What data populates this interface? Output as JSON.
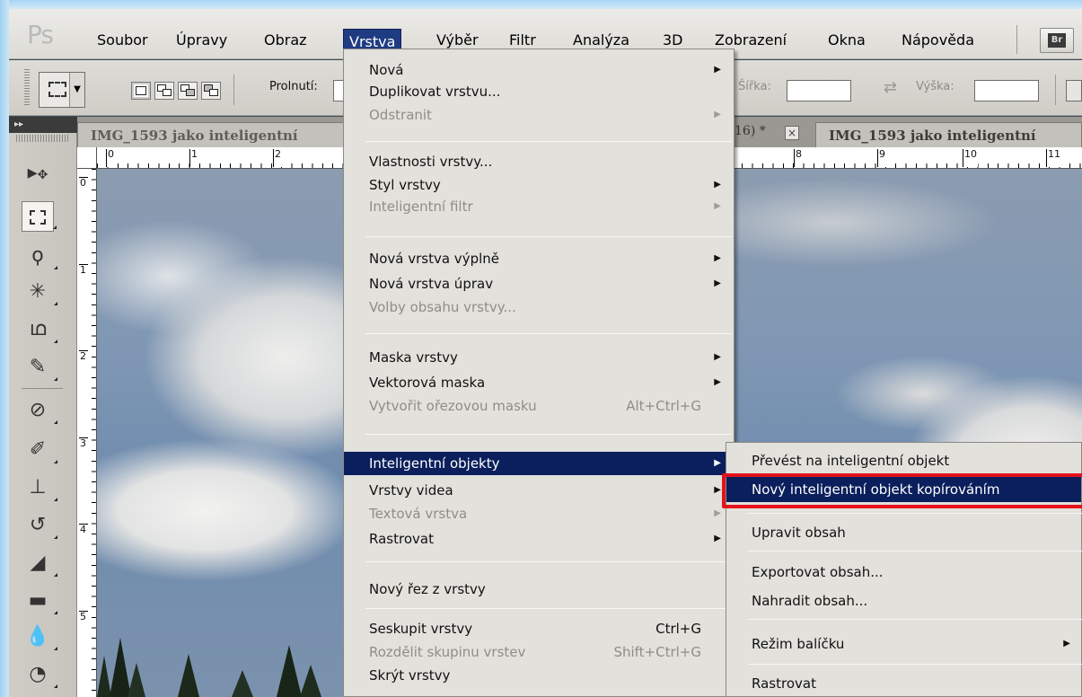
{
  "menubar": {
    "logo": "Ps",
    "items": [
      "Soubor",
      "Úpravy",
      "Obraz",
      "Vrstva",
      "Výběr",
      "Filtr",
      "Analýza",
      "3D",
      "Zobrazení",
      "Okna",
      "Nápověda"
    ],
    "active": "Vrstva",
    "bridge_label": "Br"
  },
  "options": {
    "feather_label": "Prolnutí:",
    "width_label": "Šířka:",
    "height_label": "Výška:"
  },
  "tabs": {
    "left": "IMG_1593 jako inteligentní",
    "mid_fragment": "16) *",
    "close": "×",
    "right": "IMG_1593 jako inteligentní"
  },
  "rulers": {
    "top": [
      "0",
      "1",
      "2",
      "8",
      "9",
      "10",
      "11"
    ],
    "left": [
      "0",
      "1",
      "2",
      "3",
      "4",
      "5"
    ]
  },
  "tools": [
    "move-icon",
    "marquee-icon",
    "lasso-icon",
    "magic-wand-icon",
    "crop-icon",
    "eyedropper-icon",
    "healing-brush-icon",
    "brush-icon",
    "clone-stamp-icon",
    "history-brush-icon",
    "eraser-icon",
    "gradient-icon",
    "blur-icon",
    "dodge-icon"
  ],
  "layer_menu": {
    "items": [
      {
        "label": "Nová",
        "submenu": true
      },
      {
        "label": "Duplikovat vrstvu..."
      },
      {
        "label": "Odstranit",
        "submenu": true,
        "disabled": true
      },
      {
        "label": "Vlastnosti vrstvy..."
      },
      {
        "label": "Styl vrstvy",
        "submenu": true
      },
      {
        "label": "Inteligentní filtr",
        "submenu": true,
        "disabled": true
      },
      {
        "label": "Nová vrstva výplně",
        "submenu": true
      },
      {
        "label": "Nová vrstva úprav",
        "submenu": true
      },
      {
        "label": "Volby obsahu vrstvy...",
        "disabled": true
      },
      {
        "label": "Maska vrstvy",
        "submenu": true
      },
      {
        "label": "Vektorová maska",
        "submenu": true
      },
      {
        "label": "Vytvořit ořezovou masku",
        "shortcut": "Alt+Ctrl+G",
        "disabled": true
      },
      {
        "label": "Inteligentní objekty",
        "submenu": true,
        "highlighted": true
      },
      {
        "label": "Vrstvy videa",
        "submenu": true
      },
      {
        "label": "Textová vrstva",
        "submenu": true,
        "disabled": true
      },
      {
        "label": "Rastrovat",
        "submenu": true
      },
      {
        "label": "Nový řez z vrstvy"
      },
      {
        "label": "Seskupit vrstvy",
        "shortcut": "Ctrl+G"
      },
      {
        "label": "Rozdělit skupinu vrstev",
        "shortcut": "Shift+Ctrl+G",
        "disabled": true
      },
      {
        "label": "Skrýt vrstvy"
      }
    ]
  },
  "smart_objects_submenu": {
    "items": [
      {
        "label": "Převést na inteligentní objekt"
      },
      {
        "label": "Nový inteligentní objekt kopírováním",
        "highlighted": true
      },
      {
        "label": "Upravit obsah"
      },
      {
        "label": "Exportovat obsah..."
      },
      {
        "label": "Nahradit obsah..."
      },
      {
        "label": "Režim balíčku",
        "submenu": true
      },
      {
        "label": "Rastrovat"
      }
    ]
  },
  "colors": {
    "menu_highlight": "#0b1f5c",
    "annotation_red": "#e3121b"
  }
}
